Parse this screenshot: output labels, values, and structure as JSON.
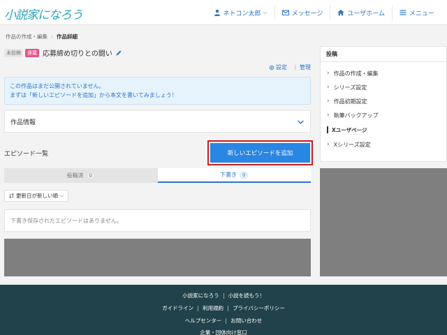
{
  "header": {
    "logo": "小説家になろう",
    "nav": [
      {
        "label": "ネトコン太郎",
        "icon": "user-icon",
        "dropdown": true
      },
      {
        "label": "メッセージ",
        "icon": "mail-icon",
        "dropdown": false
      },
      {
        "label": "ユーザホーム",
        "icon": "home-icon",
        "dropdown": false
      },
      {
        "label": "メニュー",
        "icon": "menu-icon",
        "dropdown": false
      }
    ]
  },
  "breadcrumb": [
    "作品の作成・編集",
    "作品詳細"
  ],
  "work": {
    "badge_status": "未投稿",
    "badge_type": "連載",
    "title": "応募締め切りとの闘い",
    "settings_label": "設定",
    "manage_label": "管理"
  },
  "notice": {
    "line1": "この作品はまだ公開されていません。",
    "line2": "まずは「新しいエピソードを追加」から本文を書いてみましょう！"
  },
  "work_info_label": "作品情報",
  "episodes": {
    "title": "エピソード一覧",
    "add_button": "新しいエピソードを追加",
    "tabs": [
      {
        "label": "投稿済",
        "count": "0",
        "active": false
      },
      {
        "label": "下書き",
        "count": "0",
        "active": true
      }
    ],
    "sort_label": "更新日が新しい順",
    "empty_message": "下書き保存されたエピソードはありません。"
  },
  "sidebar": {
    "heading": "投稿",
    "items": [
      "作品の作成・編集",
      "シリーズ設定",
      "作品初期設定",
      "執筆バックアップ"
    ],
    "section": "Xユーザページ",
    "section_items": [
      "Xシリーズ設定"
    ]
  },
  "footer": {
    "row1": [
      "小説家になろう",
      "小説を読もう！"
    ],
    "row2": [
      "ガイドライン",
      "利用規約",
      "プライバシーポリシー"
    ],
    "row3": [
      "ヘルプセンター",
      "お問い合わせ"
    ],
    "row4": [
      "企業・団体向け窓口"
    ]
  },
  "colors": {
    "accent": "#2b73c9",
    "button": "#2a86e3",
    "highlight_border": "#c41d1d",
    "footer_bg": "#21424a",
    "badge_serial": "#e8528a"
  }
}
